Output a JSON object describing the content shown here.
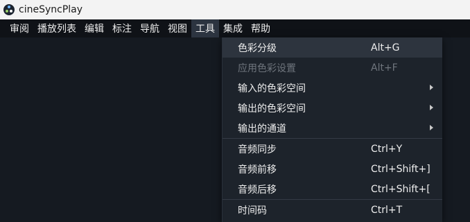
{
  "window": {
    "title": "cineSyncPlay",
    "icon": "cinesync-logo-icon"
  },
  "menubar": {
    "items": [
      {
        "label": "审阅"
      },
      {
        "label": "播放列表"
      },
      {
        "label": "编辑"
      },
      {
        "label": "标注"
      },
      {
        "label": "导航"
      },
      {
        "label": "视图"
      },
      {
        "label": "工具",
        "active": true
      },
      {
        "label": "集成"
      },
      {
        "label": "帮助"
      }
    ]
  },
  "tools_menu": {
    "items": [
      {
        "label": "色彩分级",
        "shortcut": "Alt+G",
        "highlighted": true
      },
      {
        "label": "应用色彩设置",
        "shortcut": "Alt+F",
        "disabled": true
      },
      {
        "label": "输入的色彩空间",
        "submenu": true
      },
      {
        "label": "输出的色彩空间",
        "submenu": true
      },
      {
        "label": "输出的通道",
        "submenu": true
      },
      {
        "label": "音频同步",
        "shortcut": "Ctrl+Y"
      },
      {
        "label": "音频前移",
        "shortcut": "Ctrl+Shift+]"
      },
      {
        "label": "音频后移",
        "shortcut": "Ctrl+Shift+["
      },
      {
        "label": "时间码",
        "shortcut": "Ctrl+T"
      }
    ]
  },
  "colors": {
    "titlebar_bg": "#f3f3f3",
    "menubar_bg": "#0f1217",
    "dropdown_bg": "#1d232b",
    "highlight_bg": "#2d343e",
    "disabled_text": "#6f757d"
  }
}
